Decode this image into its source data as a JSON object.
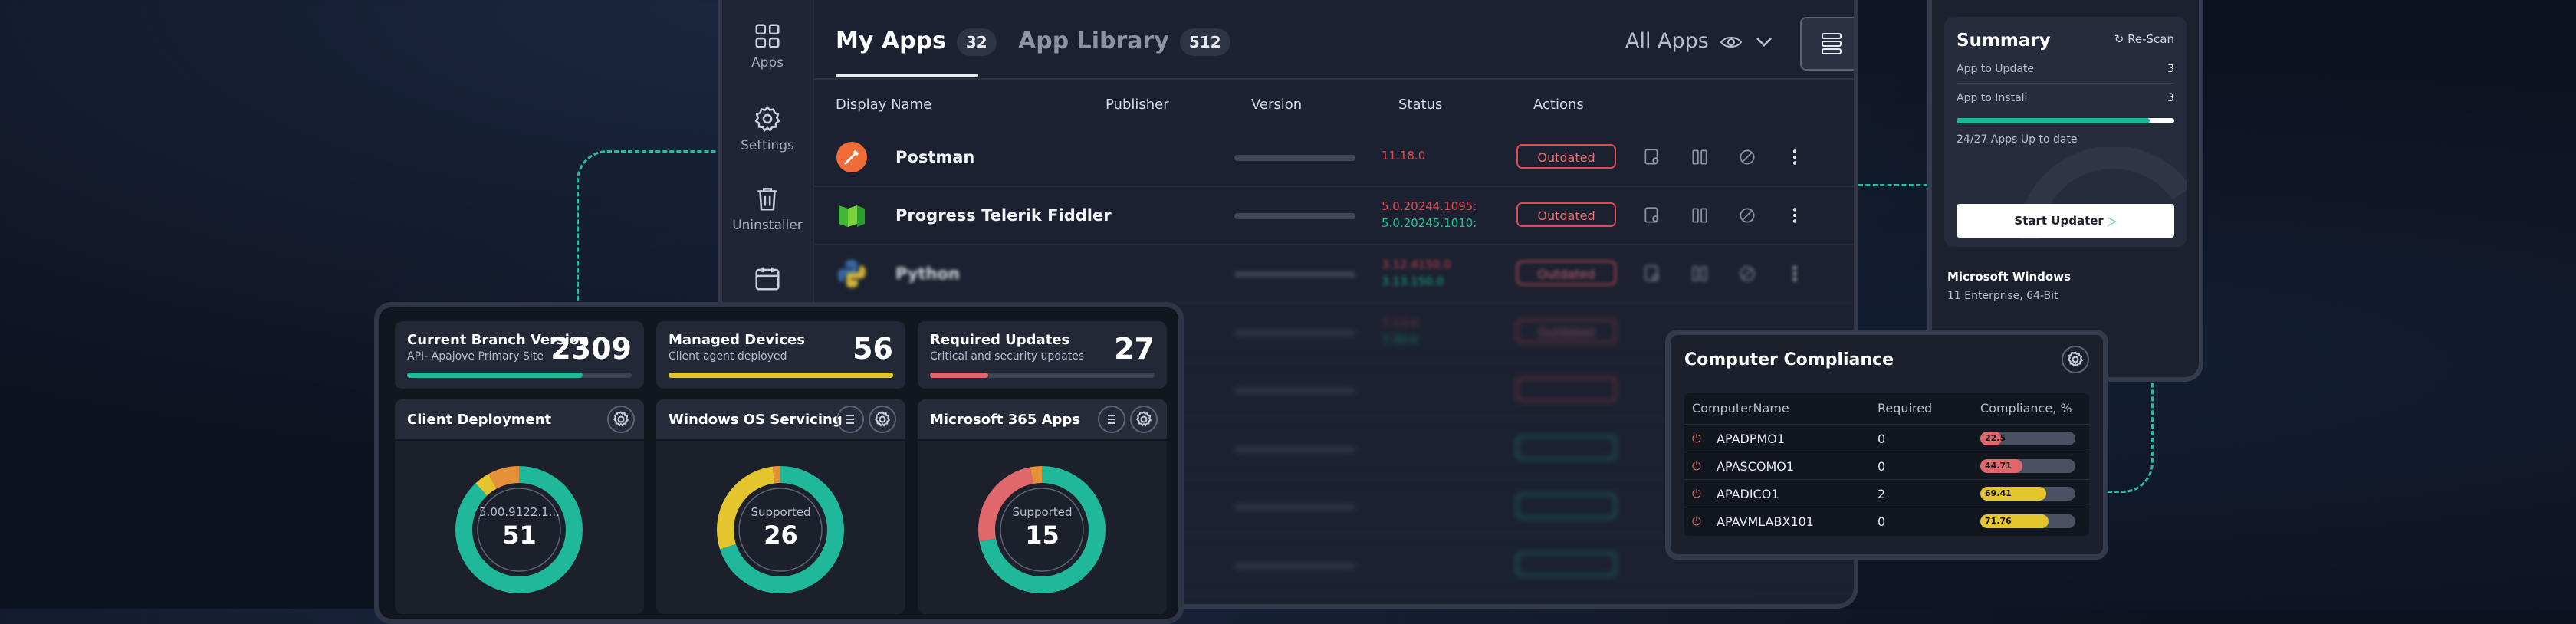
{
  "sidebar": {
    "items": [
      {
        "label": "Apps"
      },
      {
        "label": "Settings"
      },
      {
        "label": "Uninstaller"
      }
    ]
  },
  "tabs": [
    {
      "label": "My Apps",
      "count": "32"
    },
    {
      "label": "App Library",
      "count": "512"
    }
  ],
  "filter": {
    "label": "All Apps"
  },
  "table": {
    "headers": [
      "Display Name",
      "Publisher",
      "Version",
      "Status",
      "Actions"
    ],
    "rows": [
      {
        "name": "Postman",
        "version_current": "11.18.0",
        "version_new": "",
        "status": "Outdated"
      },
      {
        "name": "Progress Telerik Fiddler",
        "version_current": "5.0.20244.1095:",
        "version_new": "5.0.20245.1010:",
        "status": "Outdated"
      },
      {
        "name": "Python",
        "version_current": "3.12.4150.0",
        "version_new": "3.13.150.0",
        "status": "Outdated"
      },
      {
        "name": "",
        "version_current": "7.13.0",
        "version_new": "7.30.0",
        "status": "Outdated"
      }
    ]
  },
  "dashboard": {
    "stats": [
      {
        "title": "Current Branch Version",
        "subtitle": "API- Apajove Primary Site",
        "value": "2309",
        "progress": 0.78,
        "color": "#20b89a"
      },
      {
        "title": "Managed Devices",
        "subtitle": "Client agent deployed",
        "value": "56",
        "progress": 1.0,
        "color": "#e5c52d"
      },
      {
        "title": "Required Updates",
        "subtitle": "Critical and security updates",
        "value": "27",
        "progress": 0.26,
        "color": "#e0686c"
      }
    ],
    "panels": [
      {
        "title": "Client Deployment",
        "center_top": "5.00.9122.1...",
        "center_value": "51"
      },
      {
        "title": "Windows OS Servicing",
        "center_top": "Supported",
        "center_value": "26"
      },
      {
        "title": "Microsoft 365 Apps",
        "center_top": "Supported",
        "center_value": "15"
      }
    ]
  },
  "summary": {
    "title": "Summary",
    "rescan": "Re-Scan",
    "rows": [
      {
        "label": "App to Update",
        "value": "3"
      },
      {
        "label": "App to Install",
        "value": "3"
      }
    ],
    "progress": 0.889,
    "progress_text": "24/27 Apps Up to date",
    "button": "Start Updater",
    "os_title": "Microsoft Windows",
    "os_sub": "11 Enterprise, 64-Bit"
  },
  "compliance": {
    "title": "Computer Compliance",
    "headers": [
      "ComputerName",
      "Required",
      "Compliance, %"
    ],
    "rows": [
      {
        "name": "APADPMO1",
        "required": "0",
        "pct": "22.5",
        "value": 22.5,
        "color": "#e0686c"
      },
      {
        "name": "APASCOMO1",
        "required": "0",
        "pct": "44.71",
        "value": 44.71,
        "color": "#e0686c"
      },
      {
        "name": "APADICO1",
        "required": "2",
        "pct": "69.41",
        "value": 69.41,
        "color": "#e5c52d"
      },
      {
        "name": "APAVMLABX101",
        "required": "0",
        "pct": "71.76",
        "value": 71.76,
        "color": "#e5c52d"
      }
    ]
  }
}
